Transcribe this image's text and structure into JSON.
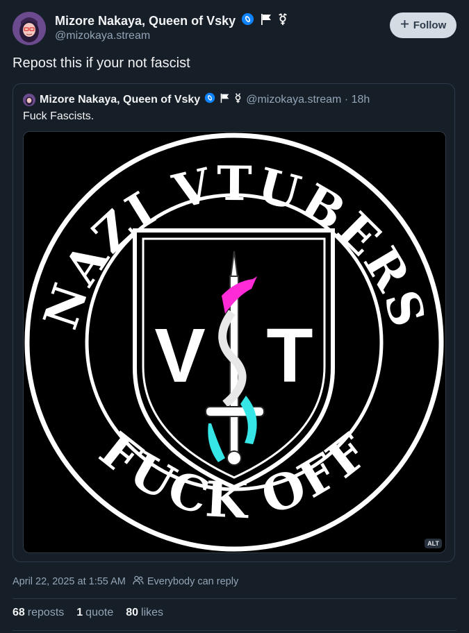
{
  "author": {
    "display_name": "Mizore Nakaya, Queen of Vsky",
    "handle": "@mizokaya.stream",
    "badges": [
      "verified-badge-icon",
      "white-flag-icon",
      "trans-symbol-icon"
    ]
  },
  "follow_button": {
    "label": "Follow",
    "icon": "plus-icon"
  },
  "post": {
    "text": "Repost this if your not fascist"
  },
  "quoted_post": {
    "display_name": "Mizore Nakaya, Queen of Vsky",
    "handle_time": "@mizokaya.stream · 18h",
    "text": "Fuck Fascists.",
    "image": {
      "top_text": "NAZI VTUBERS",
      "bottom_text": "FUCK OFF",
      "shield_left": "V",
      "shield_right": "T",
      "alt_badge": "ALT"
    }
  },
  "meta": {
    "timestamp": "April 22, 2025 at 1:55 AM",
    "reply_setting": "Everybody can reply"
  },
  "stats": {
    "reposts_count": "68",
    "reposts_label": "reposts",
    "quotes_count": "1",
    "quotes_label": "quote",
    "likes_count": "80",
    "likes_label": "likes"
  },
  "colors": {
    "background": "#161e27",
    "secondary_text": "#93a5b7",
    "accent": "#1083fe",
    "pink": "#ff2bd6",
    "cyan": "#36e5e5"
  }
}
